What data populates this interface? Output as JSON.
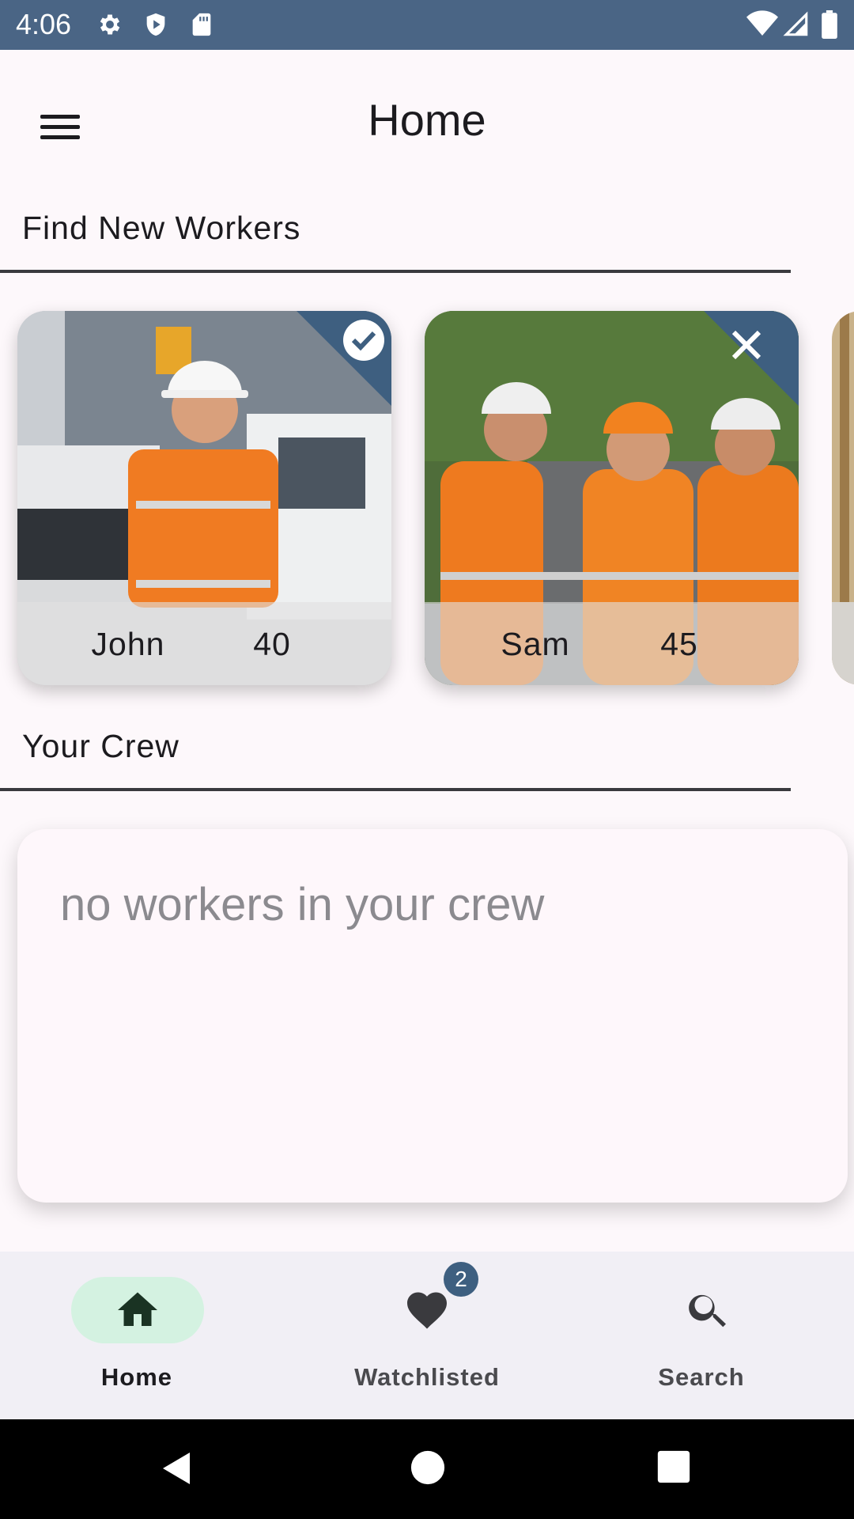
{
  "status_bar": {
    "time": "4:06",
    "background": "#4a6585",
    "left_icons": [
      "settings-icon",
      "shield-play-icon",
      "sd-card-icon"
    ],
    "right_icons": [
      "wifi-icon",
      "signal-icon",
      "battery-icon"
    ]
  },
  "app_bar": {
    "title": "Home",
    "menu_icon": "menu-icon"
  },
  "find_workers": {
    "title": "Find New Workers",
    "workers": [
      {
        "name": "John",
        "age": "40",
        "status_icon": "check-circle-icon"
      },
      {
        "name": "Sam",
        "age": "45",
        "status_icon": "close-icon"
      }
    ]
  },
  "crew": {
    "title": "Your Crew",
    "empty_message": "no workers in your crew"
  },
  "bottom_nav": {
    "items": [
      {
        "label": "Home",
        "icon": "home-icon",
        "selected": true
      },
      {
        "label": "Watchlisted",
        "icon": "heart-icon",
        "badge": "2"
      },
      {
        "label": "Search",
        "icon": "search-icon"
      }
    ],
    "active_color": "#d4f2e1",
    "badge_color": "#3e5f80"
  },
  "system_nav": {
    "icons": [
      "back-icon",
      "home-circle-icon",
      "recents-icon"
    ]
  }
}
